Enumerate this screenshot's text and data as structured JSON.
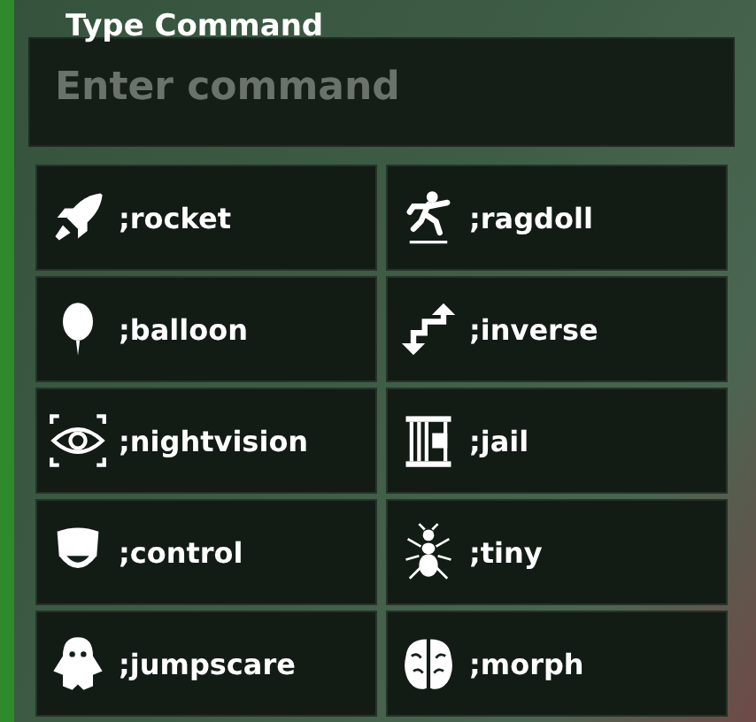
{
  "title": "Type Command",
  "command_field": {
    "placeholder": "Enter command"
  },
  "commands": [
    {
      "label": ";rocket"
    },
    {
      "label": ";ragdoll"
    },
    {
      "label": ";balloon"
    },
    {
      "label": ";inverse"
    },
    {
      "label": ";nightvision"
    },
    {
      "label": ";jail"
    },
    {
      "label": ";control"
    },
    {
      "label": ";tiny"
    },
    {
      "label": ";jumpscare"
    },
    {
      "label": ";morph"
    }
  ]
}
